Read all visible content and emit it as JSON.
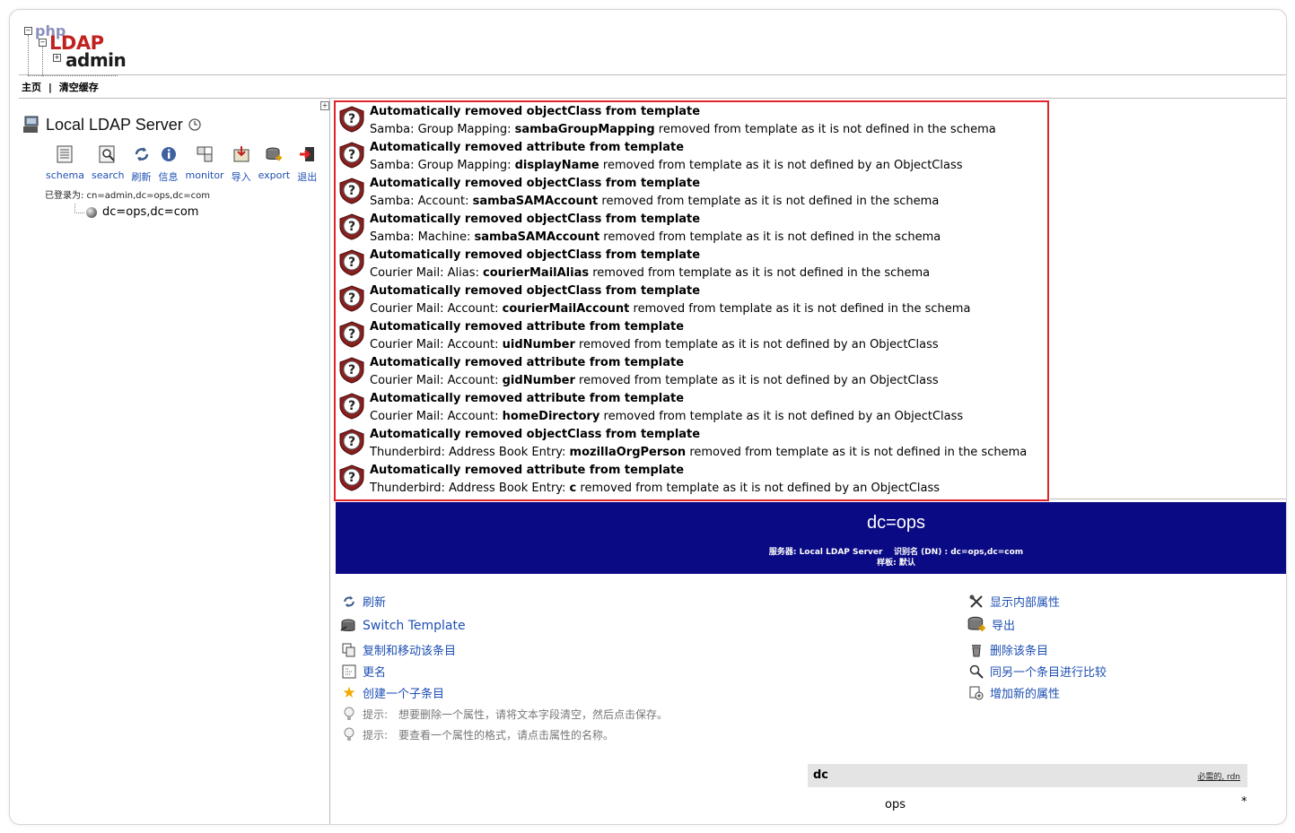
{
  "logo": {
    "php": "php",
    "ldap": "LDAP",
    "admin": "admin"
  },
  "breadcrumb": {
    "home": "主页",
    "sep": "|",
    "purge": "清空缓存"
  },
  "server": {
    "name": "Local LDAP Server"
  },
  "toolbar": [
    {
      "label": "schema",
      "icon": "schema-icon"
    },
    {
      "label": "search",
      "icon": "search-icon"
    },
    {
      "label": "刷新",
      "icon": "refresh-icon"
    },
    {
      "label": "信息",
      "icon": "info-icon"
    },
    {
      "label": "monitor",
      "icon": "monitor-icon"
    },
    {
      "label": "导入",
      "icon": "import-icon"
    },
    {
      "label": "export",
      "icon": "export-icon"
    },
    {
      "label": "退出",
      "icon": "logout-icon"
    }
  ],
  "logged_in": "已登录为: cn=admin,dc=ops,dc=com",
  "tree": {
    "node": "dc=ops,dc=com"
  },
  "messages": [
    {
      "title": "Automatically removed objectClass from template",
      "prefix": "Samba: Group Mapping: ",
      "name": "sambaGroupMapping",
      "suffix": " removed from template as it is not defined in the schema"
    },
    {
      "title": "Automatically removed attribute from template",
      "prefix": "Samba: Group Mapping: ",
      "name": "displayName",
      "suffix": " removed from template as it is not defined by an ObjectClass"
    },
    {
      "title": "Automatically removed objectClass from template",
      "prefix": "Samba: Account: ",
      "name": "sambaSAMAccount",
      "suffix": " removed from template as it is not defined in the schema"
    },
    {
      "title": "Automatically removed objectClass from template",
      "prefix": "Samba: Machine: ",
      "name": "sambaSAMAccount",
      "suffix": " removed from template as it is not defined in the schema"
    },
    {
      "title": "Automatically removed objectClass from template",
      "prefix": "Courier Mail: Alias: ",
      "name": "courierMailAlias",
      "suffix": " removed from template as it is not defined in the schema"
    },
    {
      "title": "Automatically removed objectClass from template",
      "prefix": "Courier Mail: Account: ",
      "name": "courierMailAccount",
      "suffix": " removed from template as it is not defined in the schema"
    },
    {
      "title": "Automatically removed attribute from template",
      "prefix": "Courier Mail: Account: ",
      "name": "uidNumber",
      "suffix": " removed from template as it is not defined by an ObjectClass"
    },
    {
      "title": "Automatically removed attribute from template",
      "prefix": "Courier Mail: Account: ",
      "name": "gidNumber",
      "suffix": " removed from template as it is not defined by an ObjectClass"
    },
    {
      "title": "Automatically removed attribute from template",
      "prefix": "Courier Mail: Account: ",
      "name": "homeDirectory",
      "suffix": " removed from template as it is not defined by an ObjectClass"
    },
    {
      "title": "Automatically removed objectClass from template",
      "prefix": "Thunderbird: Address Book Entry: ",
      "name": "mozillaOrgPerson",
      "suffix": " removed from template as it is not defined in the schema"
    },
    {
      "title": "Automatically removed attribute from template",
      "prefix": "Thunderbird: Address Book Entry: ",
      "name": "c",
      "suffix": " removed from template as it is not defined by an ObjectClass"
    }
  ],
  "entry": {
    "dn": "dc=ops",
    "info_line1": "服务器: Local LDAP Server    识别名 (DN) : dc=ops,dc=com",
    "info_line2": "样板: 默认"
  },
  "actions_left": [
    {
      "label": "刷新",
      "icon": "refresh-icon"
    },
    {
      "label": "Switch Template",
      "icon": "switch-template-icon"
    },
    {
      "label": "复制和移动该条目",
      "icon": "copy-icon"
    },
    {
      "label": "更名",
      "icon": "rename-icon"
    },
    {
      "label": "创建一个子条目",
      "icon": "star-icon"
    }
  ],
  "actions_right": [
    {
      "label": "显示内部属性",
      "icon": "tools-icon"
    },
    {
      "label": "导出",
      "icon": "export-icon"
    },
    {
      "label": "删除该条目",
      "icon": "trash-icon"
    },
    {
      "label": "同另一个条目进行比较",
      "icon": "compare-icon"
    },
    {
      "label": "增加新的属性",
      "icon": "add-attribute-icon"
    }
  ],
  "hints": [
    {
      "label": "提示:",
      "text": "想要删除一个属性，请将文本字段清空，然后点击保存。"
    },
    {
      "label": "提示:",
      "text": "要查看一个属性的格式，请点击属性的名称。"
    }
  ],
  "attribute": {
    "name": "dc",
    "flags": "必需的, rdn",
    "value": "ops",
    "required_mark": "*"
  }
}
